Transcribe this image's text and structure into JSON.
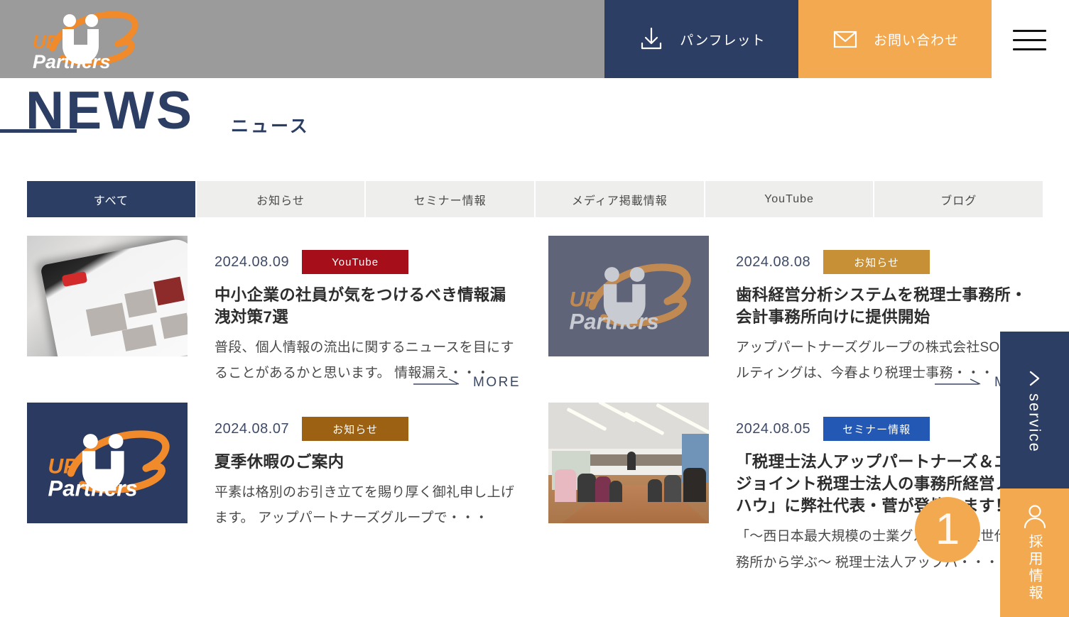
{
  "header": {
    "logo_alt": "UP Partners",
    "buttons": [
      {
        "label": "パンフレット",
        "icon": "download-icon",
        "bg": "#2c3e63"
      },
      {
        "label": "お問い合わせ",
        "icon": "mail-icon",
        "bg": "#f2a950"
      }
    ],
    "menu_icon": "hamburger-menu-icon"
  },
  "page_title": {
    "en": "NEWS",
    "ja": "ニュース",
    "color": "#2c3e63"
  },
  "tabs": [
    {
      "label": "すべて",
      "active": true
    },
    {
      "label": "お知らせ",
      "active": false
    },
    {
      "label": "セミナー情報",
      "active": false
    },
    {
      "label": "メディア掲載情報",
      "active": false
    },
    {
      "label": "YouTube",
      "active": false
    },
    {
      "label": "ブログ",
      "active": false
    }
  ],
  "more_label": "MORE",
  "news": [
    {
      "date": "2024.08.09",
      "badge": "YouTube",
      "badge_color": "#a60f1a",
      "title": "中小企業の社員が気をつけるべき情報漏洩対策7選",
      "desc": "普段、個人情報の流出に関するニュースを目にすることがあるかと思います。 情報漏え・・・",
      "thumb": "photo-tablet-youtube"
    },
    {
      "date": "2024.08.08",
      "badge": "お知らせ",
      "badge_color": "#c79036",
      "title": "歯科経営分析システムを税理士事務所・会計事務所向けに提供開始",
      "desc": "アップパートナーズグループの株式会社SOコンサルティングは、今春より税理士事務・・・",
      "thumb": "logo-slate"
    },
    {
      "date": "2024.08.07",
      "badge": "お知らせ",
      "badge_color": "#9c6112",
      "title": "夏季休暇のご案内",
      "desc": "平素は格別のお引き立てを賜り厚く御礼申し上げます。 アップパートナーズグループで・・・",
      "thumb": "logo-navy"
    },
    {
      "date": "2024.08.05",
      "badge": "セミナー情報",
      "badge_color": "#2359b5",
      "title": "「税理士法人アップパートナーズ＆エイジョイント税理士法人の事務所経営ノウハウ」に弊社代表・菅が登壇します！",
      "desc": "「〜西日本最大規模の士業グループと次世代の事務所から学ぶ〜 税理士法人アップパ・・・",
      "thumb": "photo-seminar-room"
    }
  ],
  "side_panel": {
    "service": {
      "label": "service",
      "icon": "chevron-right-icon",
      "bg": "#2c3e63"
    },
    "recruit": {
      "label": "採用情報",
      "icon": "person-icon",
      "bg": "#f2a950"
    }
  },
  "page_indicator": {
    "number": "1",
    "color": "#f2a950"
  }
}
